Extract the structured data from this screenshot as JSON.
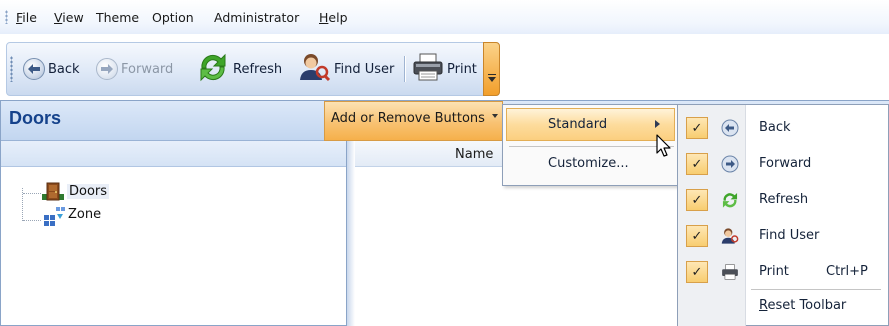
{
  "menubar": {
    "items": [
      {
        "label": "File"
      },
      {
        "label": "View"
      },
      {
        "label": "Theme"
      },
      {
        "label": "Option"
      },
      {
        "label": "Administrator"
      },
      {
        "label": "Help"
      }
    ]
  },
  "toolbar": {
    "back_label": "Back",
    "forward_label": "Forward",
    "refresh_label": "Refresh",
    "find_user_label": "Find User",
    "print_label": "Print"
  },
  "left_panel": {
    "title": "Doors",
    "tree": [
      {
        "label": "Doors",
        "icon": "door-icon"
      },
      {
        "label": "Zone",
        "icon": "zone-icon"
      }
    ]
  },
  "right_panel": {
    "column_header": "Name"
  },
  "add_remove_buttons": {
    "label": "Add or Remove Buttons"
  },
  "menu_standard": {
    "items": [
      {
        "label": "Standard"
      },
      {
        "label": "Customize..."
      }
    ]
  },
  "menu_buttons": {
    "items": [
      {
        "label": "Back",
        "checked": true,
        "icon": "back-icon"
      },
      {
        "label": "Forward",
        "checked": true,
        "icon": "forward-icon"
      },
      {
        "label": "Refresh",
        "checked": true,
        "icon": "refresh-icon"
      },
      {
        "label": "Find User",
        "checked": true,
        "icon": "find-user-icon"
      },
      {
        "label": "Print",
        "checked": true,
        "icon": "printer-icon",
        "shortcut": "Ctrl+P"
      }
    ],
    "reset_label": "Reset Toolbar",
    "check_glyph": "✓"
  },
  "colors": {
    "highlight": "#fbcf7f",
    "header_blue": "#15428b",
    "toolbar_blue": "#cbdaef"
  }
}
